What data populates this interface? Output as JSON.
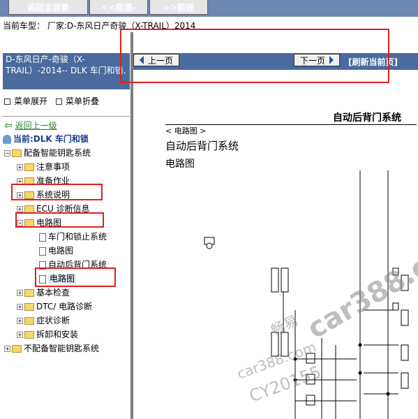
{
  "toolbar": {
    "home_label": "返回主目录",
    "prev_label": "<<后退-",
    "next_label": ">>前进"
  },
  "vehicle_line": "当前车型：  厂家:D-东风日产奇骏（X-TRAIL）2014",
  "left_title": "D-东风日产-奇骏（X-TRAIL）-2014-- DLK 车门和锁.",
  "menu": {
    "expand_label": "菜单展开",
    "collapse_label": "菜单折叠"
  },
  "tree": {
    "back_label": "返回上一级",
    "current_label": "当前:DLK 车门和锁",
    "items": [
      {
        "label": "配备智能钥匙系统"
      },
      {
        "label": "注意事项"
      },
      {
        "label": "准备作业"
      },
      {
        "label": "系统说明"
      },
      {
        "label": "ECU 诊断信息"
      },
      {
        "label": "电路图"
      },
      {
        "label": "车门和锁止系统"
      },
      {
        "label": "电路图"
      },
      {
        "label": "自动后背门系统"
      },
      {
        "label": "电路图"
      },
      {
        "label": "基本检查"
      },
      {
        "label": "DTC/ 电路诊断"
      },
      {
        "label": "症状诊断"
      },
      {
        "label": "拆卸和安装"
      },
      {
        "label": "不配备智能钥匙系统"
      }
    ]
  },
  "pager": {
    "prev_label": "上一页",
    "next_label": "下一页",
    "refresh_label": "[刷新当前页]"
  },
  "doc": {
    "header_right": "自动后背门系统",
    "crumb": "< 电路图 >",
    "title": "自动后背门系统",
    "subtitle": "电路图"
  },
  "watermark": {
    "site": "car388.com",
    "cn": "畅易",
    "site2": "car388.com",
    "code": "CY20155"
  },
  "colors": {
    "toolbar_bg": "#6d86b2",
    "header_blue": "#4a6fa5",
    "highlight_red": "#e02020",
    "watermark_gray": "#8a8a8a"
  }
}
